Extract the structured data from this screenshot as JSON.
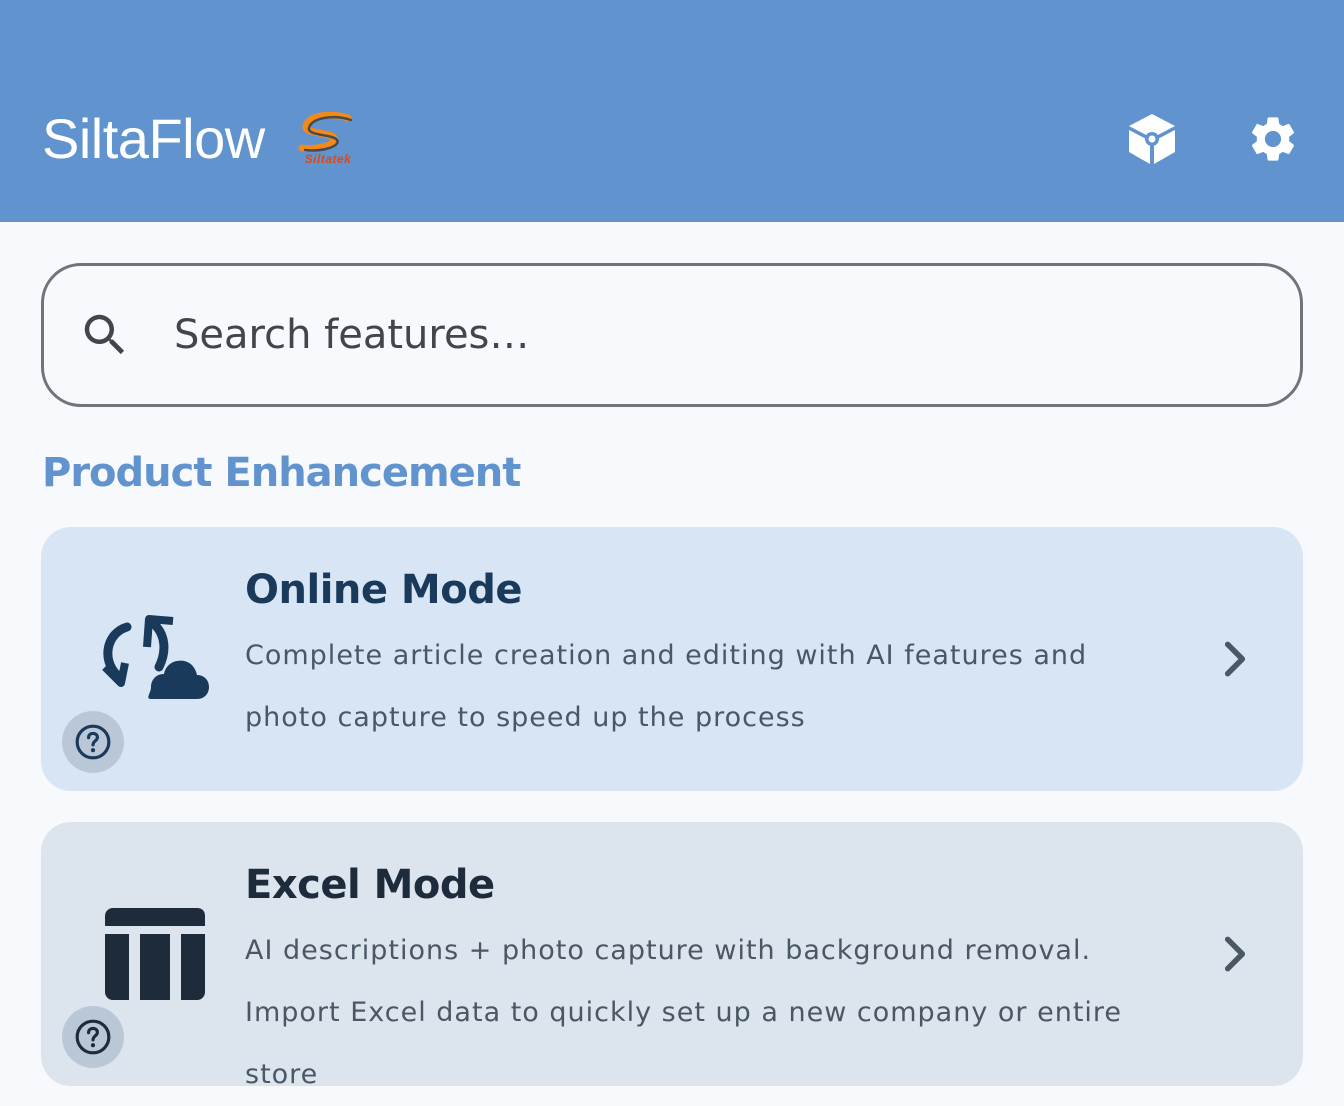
{
  "appbar": {
    "title": "SiltaFlow",
    "logo_text": "Siltatek",
    "icons": [
      "cube-icon",
      "gear-icon"
    ]
  },
  "search": {
    "placeholder": "Search features…",
    "value": ""
  },
  "section": {
    "title": "Product Enhancement"
  },
  "cards": [
    {
      "title": "Online Mode",
      "description": "Complete article creation and editing with AI features and photo capture to speed up the process",
      "icon": "sync-cloud-icon"
    },
    {
      "title": "Excel Mode",
      "description": "AI descriptions + photo capture with background removal. Import Excel data to quickly set up a new company or entire store",
      "icon": "table-icon"
    }
  ],
  "colors": {
    "appbar": "#6194cf",
    "accent": "#6194cf",
    "card_online": "#d8e5f5",
    "card_excel": "#dce4ee",
    "text_dark": "#1d2b3b"
  }
}
